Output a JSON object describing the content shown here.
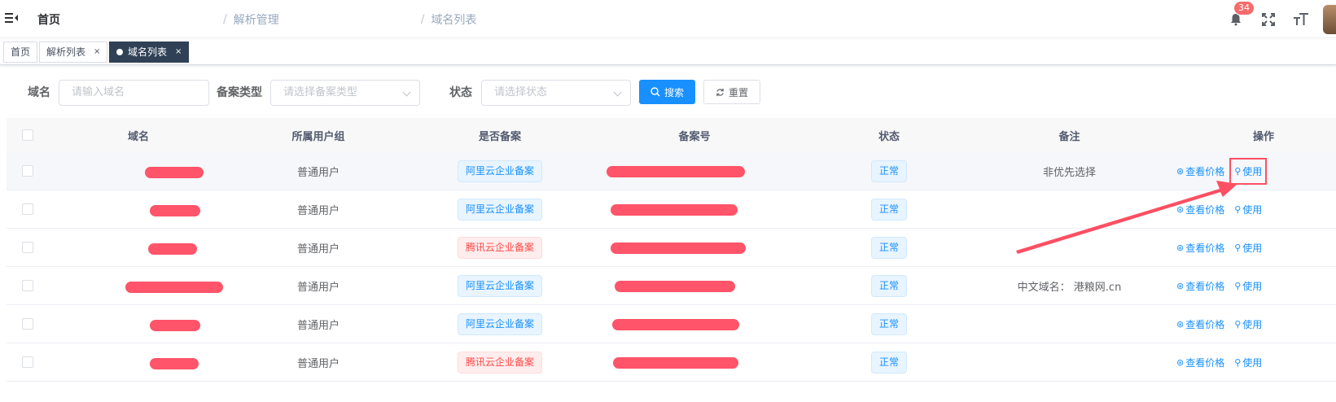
{
  "breadcrumb": [
    "首页",
    "解析管理",
    "域名列表"
  ],
  "notification_count": "34",
  "tabs": [
    {
      "label": "首页"
    },
    {
      "label": "解析列表",
      "close": "×"
    },
    {
      "label": "域名列表",
      "close": "×"
    }
  ],
  "search": {
    "domain_label": "域名",
    "domain_placeholder": "请输入域名",
    "filing_type_label": "备案类型",
    "filing_type_placeholder": "请选择备案类型",
    "status_label": "状态",
    "status_placeholder": "请选择状态",
    "search_button": "搜索",
    "reset_button": "重置"
  },
  "table": {
    "columns": [
      "域名",
      "所属用户组",
      "是否备案",
      "备案号",
      "状态",
      "备注",
      "操作"
    ],
    "rows": [
      {
        "user_group": "普通用户",
        "filing": "阿里云企业备案",
        "filing_color": "blue",
        "status": "正常",
        "remark": "非优先选择"
      },
      {
        "user_group": "普通用户",
        "filing": "阿里云企业备案",
        "filing_color": "blue",
        "status": "正常",
        "remark": ""
      },
      {
        "user_group": "普通用户",
        "filing": "腾讯云企业备案",
        "filing_color": "red",
        "status": "正常",
        "remark": ""
      },
      {
        "user_group": "普通用户",
        "filing": "阿里云企业备案",
        "filing_color": "blue",
        "status": "正常",
        "remark": "中文域名： 港粮网.cn"
      },
      {
        "user_group": "普通用户",
        "filing": "阿里云企业备案",
        "filing_color": "blue",
        "status": "正常",
        "remark": ""
      },
      {
        "user_group": "普通用户",
        "filing": "腾讯云企业备案",
        "filing_color": "red",
        "status": "正常",
        "remark": ""
      }
    ],
    "action_view_price": "查看价格",
    "action_use": "使用"
  },
  "colors": {
    "primary": "#1890ff",
    "annotation": "#ff4f63",
    "tab_active": "#304156"
  }
}
